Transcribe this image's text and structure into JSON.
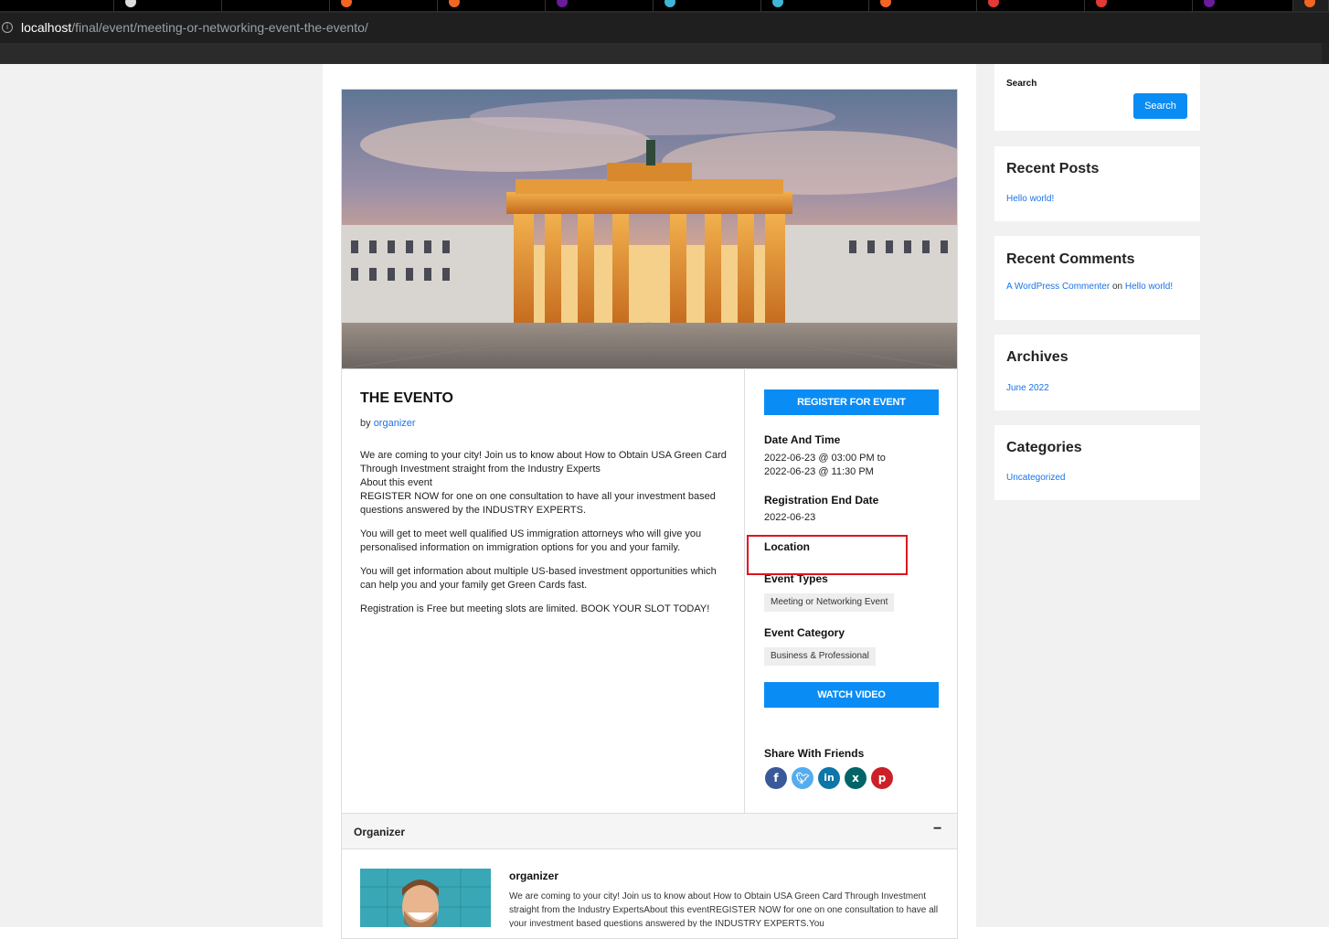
{
  "browser": {
    "url_host": "localhost",
    "url_path": "/final/event/meeting-or-networking-event-the-evento/"
  },
  "event": {
    "title": "THE EVENTO",
    "by_prefix": "by",
    "by_author": "organizer",
    "description": [
      "We are coming to your city! Join us to know about How to Obtain USA Green Card Through Investment straight from the Industry Experts",
      "About this event",
      "REGISTER NOW for one on one consultation to have all your investment based questions answered by the INDUSTRY EXPERTS.",
      "You will get to meet well qualified US immigration attorneys who will give you personalised information on immigration options for you and your family.",
      "You will get information about multiple US-based investment opportunities which can help you and your family get Green Cards fast.",
      "Registration is Free but meeting slots are limited. BOOK YOUR SLOT TODAY!"
    ],
    "register_button": "REGISTER FOR EVENT",
    "date_time_heading": "Date And Time",
    "date_time_line1": "2022-06-23 @ 03:00 PM to",
    "date_time_line2": "2022-06-23 @ 11:30 PM",
    "reg_end_heading": "Registration End Date",
    "reg_end_value": "2022-06-23",
    "location_heading": "Location",
    "event_types_heading": "Event Types",
    "event_type_tag": "Meeting or Networking Event",
    "event_category_heading": "Event Category",
    "event_category_tag": "Business & Professional",
    "watch_button": "WATCH VIDEO",
    "share_heading": "Share With Friends",
    "social_icons": [
      "facebook-icon",
      "twitter-icon",
      "linkedin-icon",
      "xing-icon",
      "pinterest-icon"
    ],
    "social_colors": [
      "#3b5998",
      "#55acee",
      "#0e76a8",
      "#026466",
      "#cb2027"
    ]
  },
  "organizer": {
    "section_title": "Organizer",
    "toggle": "−",
    "name": "organizer",
    "description": "We are coming to your city! Join us to know about How to Obtain USA Green Card Through Investment straight from the Industry ExpertsAbout this eventREGISTER NOW for one on one consultation to have all your investment based questions answered by the INDUSTRY EXPERTS.You"
  },
  "sidebar": {
    "search_label": "Search",
    "search_button": "Search",
    "recent_posts_title": "Recent Posts",
    "recent_post": "Hello world!",
    "recent_comments_title": "Recent Comments",
    "comment_author": "A WordPress Commenter",
    "comment_on": "on",
    "comment_post": "Hello world!",
    "archives_title": "Archives",
    "archive_item": "June 2022",
    "categories_title": "Categories",
    "category_item": "Uncategorized"
  },
  "colors": {
    "accent": "#0a8cf5",
    "link": "#1a73e8",
    "highlight_box": "#e0141e"
  }
}
